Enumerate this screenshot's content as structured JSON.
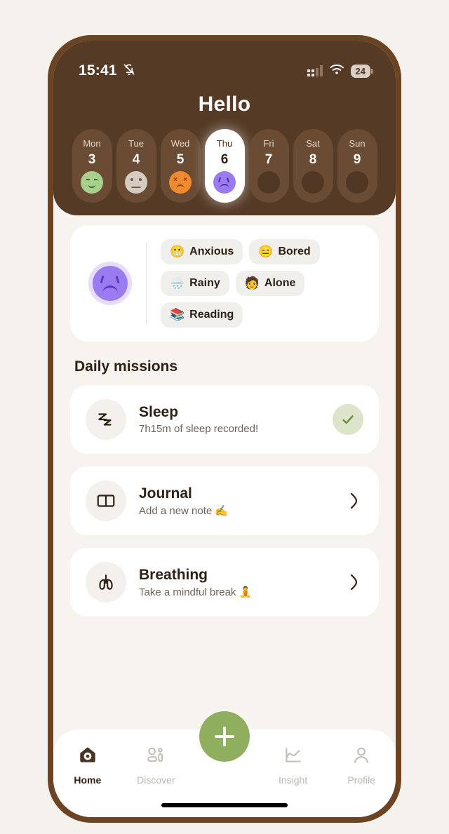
{
  "status_bar": {
    "time": "15:41",
    "bell_icon": "bell-muted-icon",
    "signal_icon": "signal-bars-icon",
    "wifi_icon": "wifi-icon",
    "battery_level": "24"
  },
  "header": {
    "greeting": "Hello",
    "background_color": "#553A26"
  },
  "week": {
    "days": [
      {
        "name": "Mon",
        "num": "3",
        "mood": "happy",
        "mood_color": "#A8D08A",
        "selected": false
      },
      {
        "name": "Tue",
        "num": "4",
        "mood": "neutral",
        "mood_color": "#D6CBC0",
        "selected": false
      },
      {
        "name": "Wed",
        "num": "5",
        "mood": "awful",
        "mood_color": "#F08A2E",
        "selected": false
      },
      {
        "name": "Thu",
        "num": "6",
        "mood": "sad",
        "mood_color": "#9B7CF0",
        "selected": true
      },
      {
        "name": "Fri",
        "num": "7",
        "mood": "none",
        "mood_color": "#4F3724",
        "selected": false
      },
      {
        "name": "Sat",
        "num": "8",
        "mood": "none",
        "mood_color": "#4F3724",
        "selected": false
      },
      {
        "name": "Sun",
        "num": "9",
        "mood": "none",
        "mood_color": "#4F3724",
        "selected": false
      }
    ]
  },
  "mood_card": {
    "avatar_mood": "sad",
    "avatar_color": "#9B7CF0",
    "tags": [
      {
        "emoji": "😬",
        "label": "Anxious"
      },
      {
        "emoji": "😑",
        "label": "Bored"
      },
      {
        "emoji": "🌧️",
        "label": "Rainy"
      },
      {
        "emoji": "🧑",
        "label": "Alone"
      },
      {
        "emoji": "📚",
        "label": "Reading"
      }
    ]
  },
  "missions": {
    "heading": "Daily missions",
    "items": [
      {
        "icon": "sleep-zz-icon",
        "title": "Sleep",
        "subtitle": "7h15m of sleep recorded!",
        "state": "completed",
        "accent_color": "#DCE5CA"
      },
      {
        "icon": "book-icon",
        "title": "Journal",
        "subtitle": "Add a new note ✍️",
        "state": "pending",
        "accent_color": "#F4F1ED"
      },
      {
        "icon": "lungs-icon",
        "title": "Breathing",
        "subtitle": "Take a mindful break 🧘",
        "state": "pending",
        "accent_color": "#F4F1ED"
      }
    ]
  },
  "bottom_nav": {
    "items": [
      {
        "label": "Home",
        "icon": "birdhouse-icon",
        "active": true
      },
      {
        "label": "Discover",
        "icon": "discover-icon",
        "active": false
      },
      {
        "label": "Insight",
        "icon": "chart-line-icon",
        "active": false
      },
      {
        "label": "Profile",
        "icon": "person-icon",
        "active": false
      }
    ],
    "fab": {
      "icon": "plus-icon",
      "color": "#8FAE5E"
    }
  }
}
